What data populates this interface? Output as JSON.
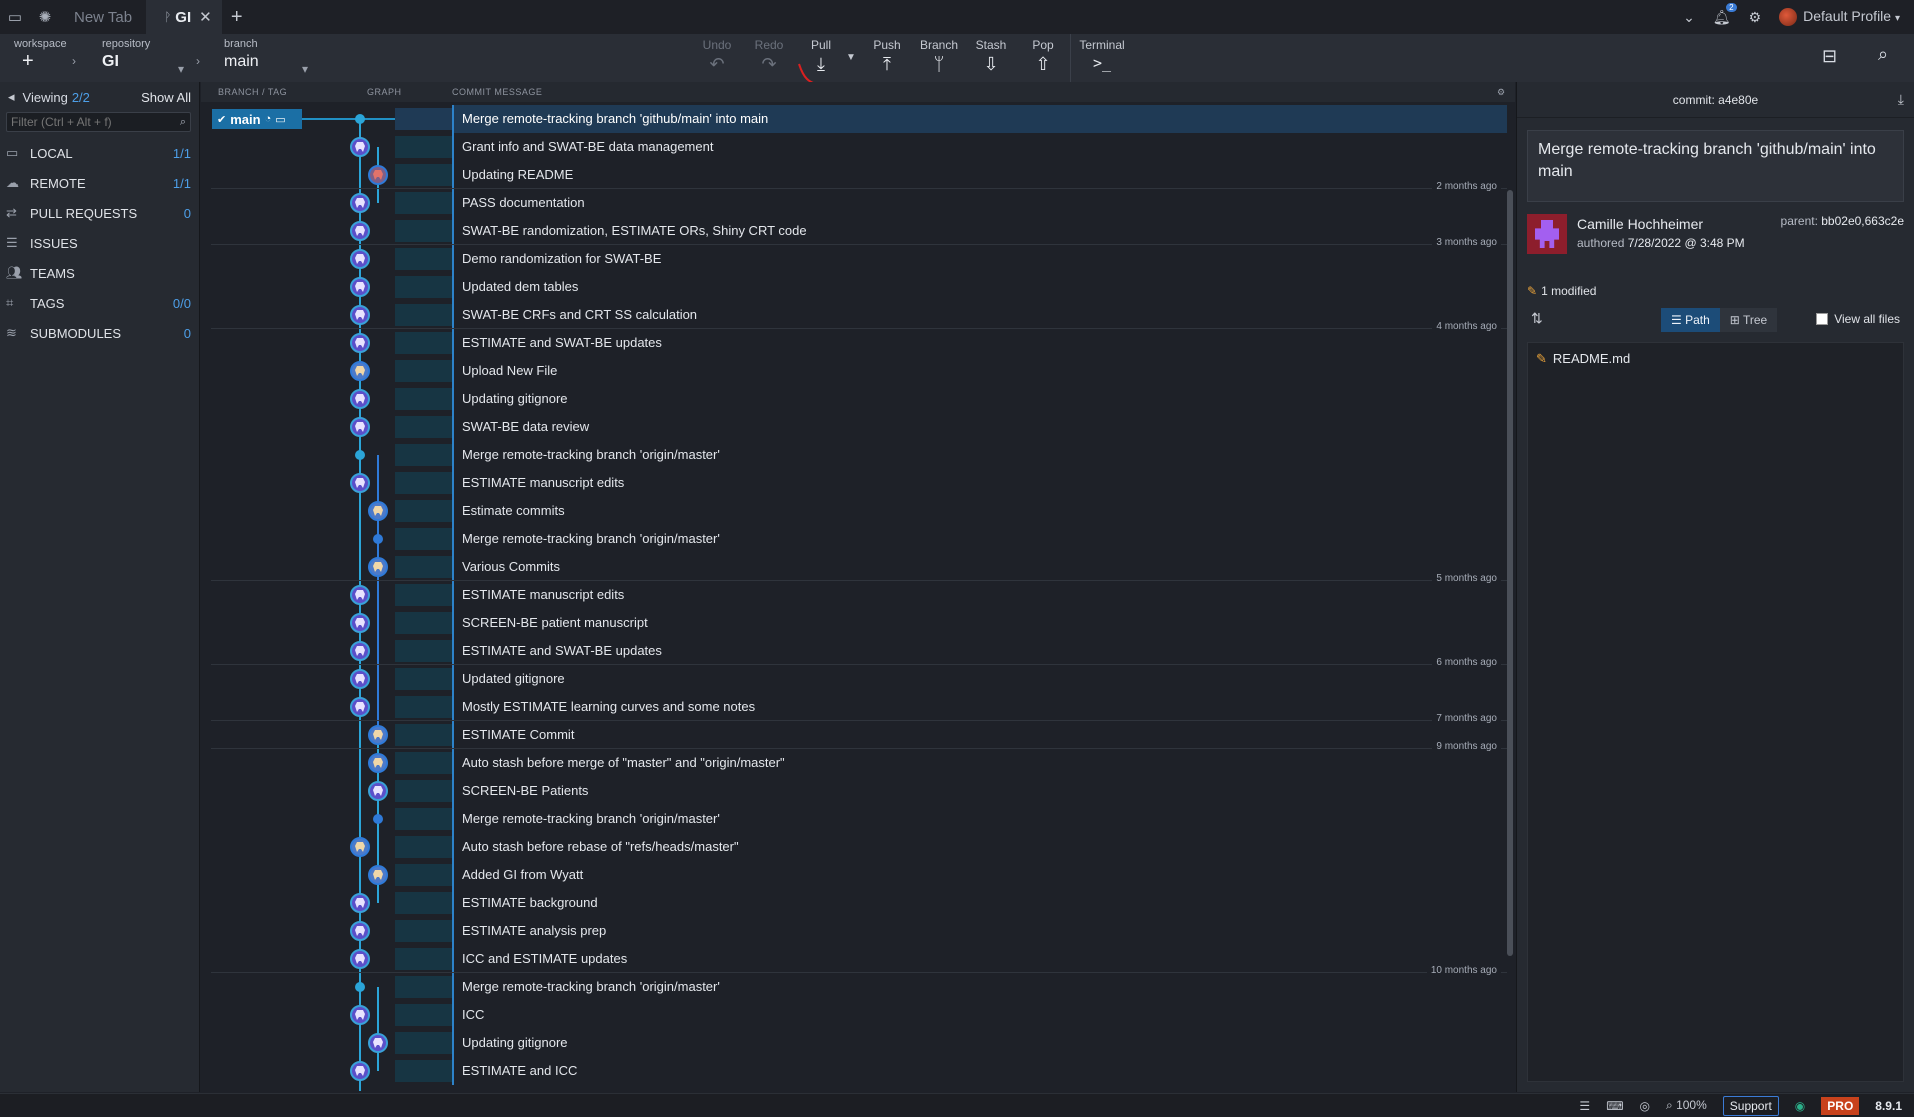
{
  "tabs": {
    "newtab_label": "New Tab",
    "active_label": "GI",
    "close": "✕",
    "add": "+"
  },
  "titlebar_right": {
    "notification_count": "2",
    "profile": "Default Profile"
  },
  "toolbar": {
    "workspace_label": "workspace",
    "repository_label": "repository",
    "repository_value": "GI",
    "branch_label": "branch",
    "branch_value": "main",
    "actions": {
      "undo": "Undo",
      "redo": "Redo",
      "pull": "Pull",
      "push": "Push",
      "branch": "Branch",
      "stash": "Stash",
      "pop": "Pop",
      "terminal": "Terminal"
    }
  },
  "left_panel": {
    "viewing_label": "Viewing",
    "viewing_count": "2/2",
    "show_all": "Show All",
    "filter_placeholder": "Filter (Ctrl + Alt + f)",
    "sections": [
      {
        "label": "LOCAL",
        "count": "1/1",
        "icon": "laptop-icon"
      },
      {
        "label": "REMOTE",
        "count": "1/1",
        "icon": "cloud-icon"
      },
      {
        "label": "PULL REQUESTS",
        "count": "0",
        "icon": "pull-request-icon"
      },
      {
        "label": "ISSUES",
        "count": "",
        "icon": "issues-icon"
      },
      {
        "label": "TEAMS",
        "count": "",
        "icon": "teams-icon"
      },
      {
        "label": "TAGS",
        "count": "0/0",
        "icon": "tag-icon"
      },
      {
        "label": "SUBMODULES",
        "count": "0",
        "icon": "submodules-icon"
      }
    ]
  },
  "graph_header": {
    "branch_tag": "BRANCH / TAG",
    "graph": "GRAPH",
    "commit_message": "COMMIT MESSAGE"
  },
  "branch_tag": {
    "name": "main"
  },
  "commits": [
    "Merge remote-tracking branch 'github/main' into main",
    "Grant info and SWAT-BE data management",
    "Updating README",
    "PASS documentation",
    "SWAT-BE randomization, ESTIMATE ORs, Shiny CRT code",
    "Demo randomization for SWAT-BE",
    "Updated dem tables",
    "SWAT-BE CRFs and CRT SS calculation",
    "ESTIMATE and SWAT-BE updates",
    "Upload New File",
    "Updating gitignore",
    "SWAT-BE data review",
    "Merge remote-tracking branch 'origin/master'",
    "ESTIMATE manuscript edits",
    "Estimate commits",
    "Merge remote-tracking branch 'origin/master'",
    "Various Commits",
    "ESTIMATE manuscript edits",
    "SCREEN-BE patient manuscript",
    "ESTIMATE and SWAT-BE updates",
    "Updated gitignore",
    "Mostly ESTIMATE learning curves and some notes",
    "ESTIMATE Commit",
    "Auto stash before merge of \"master\" and \"origin/master\"",
    "SCREEN-BE Patients",
    "Merge remote-tracking branch 'origin/master'",
    "Auto stash before rebase of \"refs/heads/master\"",
    "Added GI from Wyatt",
    "ESTIMATE background",
    "ESTIMATE analysis prep",
    "ICC and ESTIMATE updates",
    "Merge remote-tracking branch 'origin/master'",
    "ICC",
    "Updating gitignore",
    "ESTIMATE and ICC"
  ],
  "date_markers": [
    {
      "after_row": 2,
      "label": "2 months ago"
    },
    {
      "after_row": 4,
      "label": "3 months ago"
    },
    {
      "after_row": 7,
      "label": "4 months ago"
    },
    {
      "after_row": 16,
      "label": "5 months ago"
    },
    {
      "after_row": 19,
      "label": "6 months ago"
    },
    {
      "after_row": 21,
      "label": "7 months ago"
    },
    {
      "after_row": 22,
      "label": "9 months ago"
    },
    {
      "after_row": 30,
      "label": "10 months ago"
    }
  ],
  "commit_detail": {
    "commit_label": "commit:",
    "commit_sha": "a4e80e",
    "message": "Merge remote-tracking branch 'github/main' into main",
    "author": "Camille Hochheimer",
    "authored_label": "authored",
    "authored_date": "7/28/2022 @ 3:48 PM",
    "parent_label": "parent:",
    "parent_value": "bb02e0,663c2e",
    "modified": "1 modified",
    "path_label": "Path",
    "tree_label": "Tree",
    "view_all": "View all files",
    "files": [
      "README.md"
    ]
  },
  "status_bar": {
    "zoom": "100%",
    "support": "Support",
    "pro": "PRO",
    "version": "8.9.1"
  },
  "colors": {
    "accent": "#2ba5d8",
    "selected_row": "#1f3a55",
    "pro": "#c8421c"
  }
}
